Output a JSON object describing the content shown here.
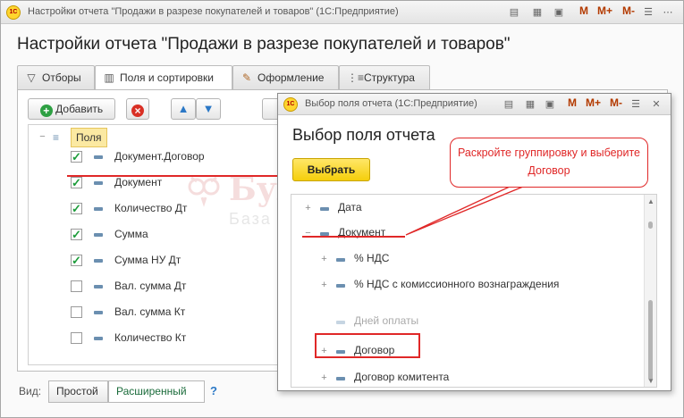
{
  "main_window": {
    "title": "Настройки отчета \"Продажи в разрезе покупателей и товаров\" (1С:Предприятие)",
    "logo": "1С",
    "form_title": "Настройки отчета \"Продажи в разрезе покупателей и товаров\"",
    "titlebar_buttons": {
      "m": "M",
      "m_plus": "M+",
      "m_minus": "M-"
    },
    "tabs": [
      {
        "label": "Отборы",
        "icon": "filter-icon"
      },
      {
        "label": "Поля и сортировки",
        "icon": "fields-icon",
        "active": true
      },
      {
        "label": "Оформление",
        "icon": "brush-icon"
      },
      {
        "label": "Структура",
        "icon": "structure-icon"
      }
    ],
    "toolbar": {
      "add_label": "Добавить"
    },
    "fields_root_label": "Поля",
    "fields": [
      {
        "label": "Документ.Договор",
        "checked": true
      },
      {
        "label": "Документ",
        "checked": true
      },
      {
        "label": "Количество Дт",
        "checked": true
      },
      {
        "label": "Сумма",
        "checked": true
      },
      {
        "label": "Сумма НУ Дт",
        "checked": true
      },
      {
        "label": "Вал. сумма Дт",
        "checked": false
      },
      {
        "label": "Вал. сумма Кт",
        "checked": false
      },
      {
        "label": "Количество Кт",
        "checked": false
      }
    ],
    "view": {
      "label": "Вид:",
      "simple": "Простой",
      "extended": "Расширенный",
      "help": "?"
    }
  },
  "watermark": {
    "title": "БухЭксперт8",
    "subtitle": "База знаний по учёту в 1С"
  },
  "dialog": {
    "title": "Выбор поля отчета (1С:Предприятие)",
    "heading": "Выбор поля отчета",
    "select_button": "Выбрать",
    "tree": [
      {
        "label": "Дата",
        "level": 0,
        "expander": "+"
      },
      {
        "label": "Документ",
        "level": 0,
        "expander": "−"
      },
      {
        "label": "% НДС",
        "level": 1,
        "expander": "+"
      },
      {
        "label": "% НДС с комиссионного вознаграждения",
        "level": 1,
        "expander": "+"
      },
      {
        "label": "Дней оплаты",
        "level": 1,
        "expander": ""
      },
      {
        "label": "Договор",
        "level": 1,
        "expander": "+"
      },
      {
        "label": "Договор комитента",
        "level": 1,
        "expander": "+"
      }
    ]
  },
  "callout": {
    "text": "Раскройте группировку и выберите Договор"
  },
  "colors": {
    "accent_red": "#e02828",
    "highlight_yellow": "#fbe9a2",
    "select_button": "#f5cf0b",
    "check_green": "#1c9c3a"
  }
}
